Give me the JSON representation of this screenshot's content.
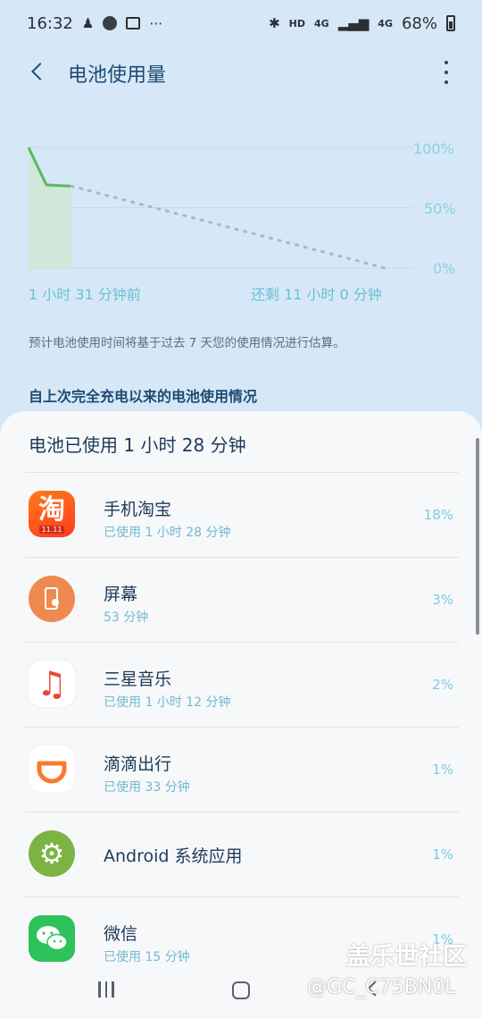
{
  "status": {
    "time": "16:32",
    "net_hd": "HD",
    "net_4g_1": "4G",
    "net_4g_2": "4G",
    "battery": "68%"
  },
  "header": {
    "title": "电池使用量"
  },
  "chart_data": {
    "type": "line",
    "series": [
      {
        "values": [
          {
            "x": "1 小时 31 分钟前",
            "y": 100
          },
          {
            "x": "",
            "y": 69
          },
          {
            "x": "now",
            "y": 68
          }
        ]
      },
      {
        "values": [
          {
            "x": "now",
            "y": 68
          },
          {
            "x": "还剩 11 小时 0 分钟",
            "y": 0
          }
        ]
      }
    ],
    "y_ticks": [
      "100%",
      "50%",
      "0%"
    ],
    "x_labels": [
      "1 小时 31 分钟前",
      "还剩 11 小时 0 分钟"
    ],
    "ylim": [
      0,
      100
    ],
    "grid": true,
    "colors": {
      "used": "#5cb85c",
      "projected": "#aab6c4",
      "fill": "#cfe7d6"
    }
  },
  "note": "预计电池使用时间将基于过去 7 天您的使用情况进行估算。",
  "section_title": "自上次完全充电以来的电池使用情况",
  "usage": {
    "summary": "电池已使用 1 小时 28 分钟",
    "apps": [
      {
        "name": "手机淘宝",
        "sub": "已使用 1 小时 28 分钟",
        "pct": "18%",
        "icon": "taobao-icon",
        "glyph": "淘",
        "badge": "11.11"
      },
      {
        "name": "屏幕",
        "sub": "53 分钟",
        "pct": "3%",
        "icon": "screen-icon"
      },
      {
        "name": "三星音乐",
        "sub": "已使用 1 小时 12 分钟",
        "pct": "2%",
        "icon": "music-icon",
        "glyph": "♫"
      },
      {
        "name": "滴滴出行",
        "sub": "已使用 33 分钟",
        "pct": "1%",
        "icon": "didi-icon"
      },
      {
        "name": "Android 系统应用",
        "sub": "",
        "pct": "1%",
        "icon": "gear-icon",
        "glyph": "⚙"
      },
      {
        "name": "微信",
        "sub": "已使用 15 分钟",
        "pct": "1%",
        "icon": "wechat-icon"
      }
    ]
  },
  "watermark": {
    "line1": "盖乐世社区",
    "line2": "@GC_C75BN0L"
  }
}
